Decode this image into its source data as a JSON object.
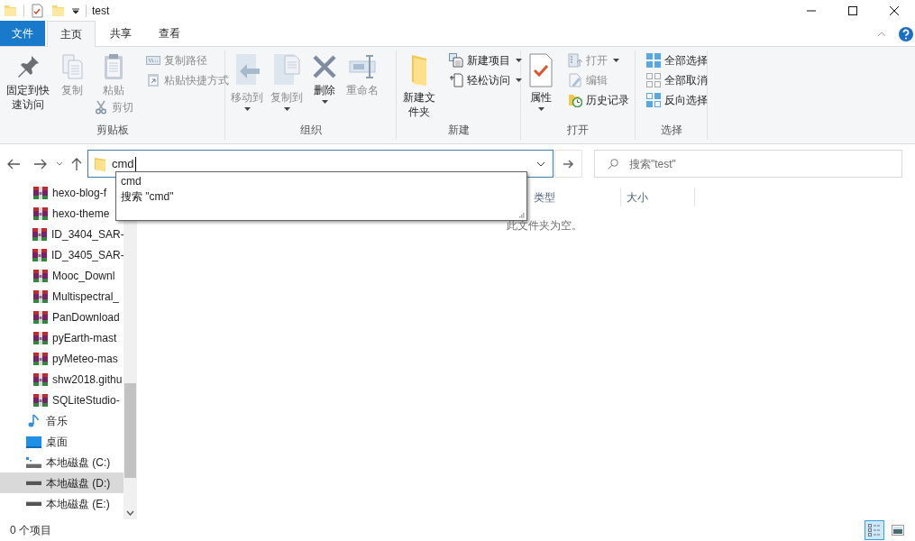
{
  "window": {
    "title": "test"
  },
  "ribbon_tabs": [
    {
      "label": "文件",
      "kind": "file",
      "selected": false
    },
    {
      "label": "主页",
      "kind": "tab",
      "selected": true
    },
    {
      "label": "共享",
      "kind": "tab",
      "selected": false
    },
    {
      "label": "查看",
      "kind": "tab",
      "selected": false
    }
  ],
  "ribbon_groups": [
    {
      "label": "剪贴板",
      "columns": [
        [
          {
            "label": "固定到快速访问",
            "kind": "large",
            "disabled": false,
            "dropdown": false
          }
        ],
        [
          {
            "label": "复制",
            "kind": "large",
            "disabled": true,
            "dropdown": false
          }
        ],
        [
          {
            "label": "粘贴",
            "kind": "large",
            "disabled": true,
            "dropdown": false
          },
          {
            "label": "剪切",
            "kind": "small",
            "disabled": true,
            "dropdown": false
          }
        ],
        [
          {
            "label": "复制路径",
            "kind": "small",
            "disabled": true,
            "dropdown": false
          },
          {
            "label": "粘贴快捷方式",
            "kind": "small",
            "disabled": true,
            "dropdown": false
          }
        ]
      ]
    },
    {
      "label": "组织",
      "columns": [
        [
          {
            "label": "移动到",
            "kind": "large",
            "disabled": true,
            "dropdown": true
          }
        ],
        [
          {
            "label": "复制到",
            "kind": "large",
            "disabled": true,
            "dropdown": true
          }
        ],
        [
          {
            "label": "删除",
            "kind": "large",
            "disabled": false,
            "dropdown": true
          }
        ],
        [
          {
            "label": "重命名",
            "kind": "large",
            "disabled": true,
            "dropdown": false
          }
        ]
      ]
    },
    {
      "label": "新建",
      "columns": [
        [
          {
            "label": "新建文件夹",
            "kind": "large",
            "disabled": false,
            "dropdown": false
          }
        ],
        [
          {
            "label": "新建项目",
            "kind": "small",
            "disabled": false,
            "dropdown": true
          },
          {
            "label": "轻松访问",
            "kind": "small",
            "disabled": false,
            "dropdown": true
          }
        ]
      ]
    },
    {
      "label": "打开",
      "columns": [
        [
          {
            "label": "属性",
            "kind": "large",
            "disabled": false,
            "dropdown": true
          }
        ],
        [
          {
            "label": "打开",
            "kind": "small",
            "disabled": true,
            "dropdown": true
          },
          {
            "label": "编辑",
            "kind": "small",
            "disabled": true,
            "dropdown": false
          },
          {
            "label": "历史记录",
            "kind": "small",
            "disabled": false,
            "dropdown": false
          }
        ]
      ]
    },
    {
      "label": "选择",
      "columns": [
        [
          {
            "label": "全部选择",
            "kind": "small",
            "disabled": false,
            "dropdown": false
          },
          {
            "label": "全部取消",
            "kind": "small",
            "disabled": false,
            "dropdown": false
          },
          {
            "label": "反向选择",
            "kind": "small",
            "disabled": false,
            "dropdown": false
          }
        ]
      ]
    }
  ],
  "address_bar": {
    "value": "cmd",
    "suggestions": [
      "cmd",
      "搜索 \"cmd\""
    ]
  },
  "search": {
    "placeholder": "搜索\"test\""
  },
  "nav_items": [
    {
      "label": "hexo-blog-f",
      "kind": "archive",
      "selected": false
    },
    {
      "label": "hexo-theme",
      "kind": "archive",
      "selected": false
    },
    {
      "label": "ID_3404_SAR-",
      "kind": "archive",
      "selected": false
    },
    {
      "label": "ID_3405_SAR-",
      "kind": "archive",
      "selected": false
    },
    {
      "label": "Mooc_Downl",
      "kind": "archive",
      "selected": false
    },
    {
      "label": "Multispectral_",
      "kind": "archive",
      "selected": false
    },
    {
      "label": "PanDownload",
      "kind": "archive",
      "selected": false
    },
    {
      "label": "pyEarth-mast",
      "kind": "archive",
      "selected": false
    },
    {
      "label": "pyMeteo-mas",
      "kind": "archive",
      "selected": false
    },
    {
      "label": "shw2018.githu",
      "kind": "archive",
      "selected": false
    },
    {
      "label": "SQLiteStudio-",
      "kind": "archive",
      "selected": false
    },
    {
      "label": "音乐",
      "kind": "music",
      "selected": false
    },
    {
      "label": "桌面",
      "kind": "desktop",
      "selected": false
    },
    {
      "label": "本地磁盘 (C:)",
      "kind": "system-drive",
      "selected": false
    },
    {
      "label": "本地磁盘 (D:)",
      "kind": "drive",
      "selected": true
    },
    {
      "label": "本地磁盘 (E:)",
      "kind": "drive",
      "selected": false
    }
  ],
  "columns": [
    "类型",
    "大小"
  ],
  "empty_message": "此文件夹为空。",
  "status_bar": {
    "item_count": "0 个项目"
  },
  "view_buttons": [
    {
      "kind": "details",
      "selected": true
    },
    {
      "kind": "large-icons",
      "selected": false
    }
  ]
}
